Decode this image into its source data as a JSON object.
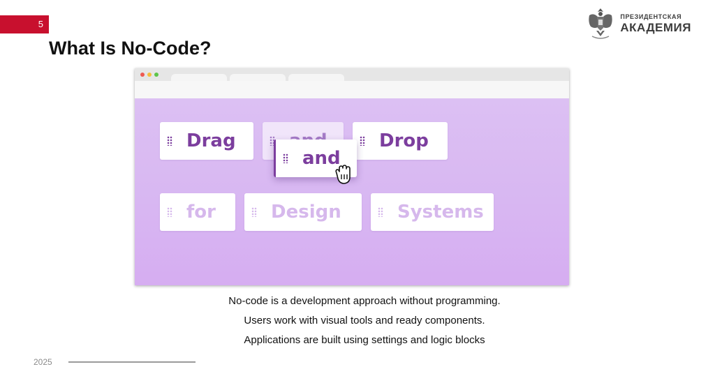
{
  "slide": {
    "number": "5",
    "title": "What Is No-Code?",
    "accent_color": "#c8102e"
  },
  "logo": {
    "icon": "eagle-emblem-icon",
    "line1": "ПРЕЗИДЕНТСКАЯ",
    "line2": "АКАДЕМИЯ"
  },
  "illustration": {
    "window_dots": [
      "#ee5a52",
      "#f5be3b",
      "#5ec54b"
    ],
    "background_color": "#d8b7f2",
    "text_color": "#7c3e9e",
    "blocks": [
      {
        "word": "Drag"
      },
      {
        "word": "and"
      },
      {
        "word": "and"
      },
      {
        "word": "Drop"
      },
      {
        "word": "for"
      },
      {
        "word": "Design"
      },
      {
        "word": "Systems"
      }
    ],
    "cursor_icon": "grab-hand-icon"
  },
  "captions": [
    "No-code is a development approach without programming.",
    "Users work with visual tools and ready components.",
    "Applications are built using settings and logic blocks"
  ],
  "footer": {
    "year": "2025"
  }
}
